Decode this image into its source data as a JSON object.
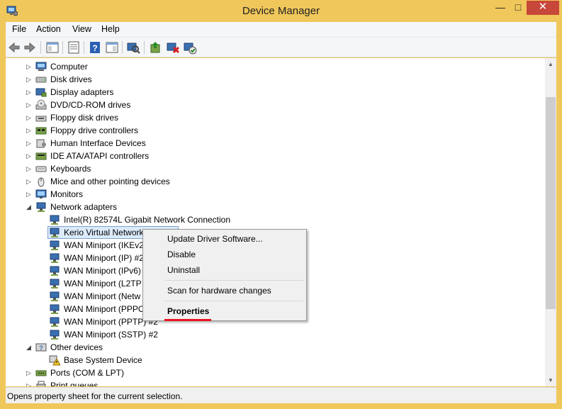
{
  "window": {
    "title": "Device Manager",
    "controls": {
      "minimize": "—",
      "maximize": "□",
      "close": "✕"
    }
  },
  "menubar": {
    "items": [
      "File",
      "Action",
      "View",
      "Help"
    ]
  },
  "toolbar": {
    "buttons": [
      "back-icon",
      "forward-icon",
      "show-hide-console-tree-icon",
      "properties-icon",
      "help-icon",
      "show-hide-action-pane-icon",
      "scan-hardware-icon",
      "update-driver-icon",
      "uninstall-icon",
      "enable-device-icon"
    ]
  },
  "tree": {
    "nodes": [
      {
        "label": "Computer",
        "expander": "▷",
        "icon": "computer-icon"
      },
      {
        "label": "Disk drives",
        "expander": "▷",
        "icon": "disk-drive-icon"
      },
      {
        "label": "Display adapters",
        "expander": "▷",
        "icon": "display-adapter-icon"
      },
      {
        "label": "DVD/CD-ROM drives",
        "expander": "▷",
        "icon": "dvd-drive-icon"
      },
      {
        "label": "Floppy disk drives",
        "expander": "▷",
        "icon": "floppy-drive-icon"
      },
      {
        "label": "Floppy drive controllers",
        "expander": "▷",
        "icon": "floppy-controller-icon"
      },
      {
        "label": "Human Interface Devices",
        "expander": "▷",
        "icon": "hid-icon"
      },
      {
        "label": "IDE ATA/ATAPI controllers",
        "expander": "▷",
        "icon": "ide-controller-icon"
      },
      {
        "label": "Keyboards",
        "expander": "▷",
        "icon": "keyboard-icon"
      },
      {
        "label": "Mice and other pointing devices",
        "expander": "▷",
        "icon": "mouse-icon"
      },
      {
        "label": "Monitors",
        "expander": "▷",
        "icon": "monitor-icon"
      },
      {
        "label": "Network adapters",
        "expander": "◢",
        "icon": "network-adapter-icon"
      },
      {
        "label": "Intel(R) 82574L Gigabit Network Connection",
        "icon": "network-card-icon"
      },
      {
        "label": "Kerio Virtual Network",
        "icon": "network-card-icon",
        "selected": true
      },
      {
        "label": "WAN Miniport (IKEv2",
        "icon": "network-card-icon"
      },
      {
        "label": "WAN Miniport (IP) #2",
        "icon": "network-card-icon"
      },
      {
        "label": "WAN Miniport (IPv6)",
        "icon": "network-card-icon"
      },
      {
        "label": "WAN Miniport (L2TP",
        "icon": "network-card-icon"
      },
      {
        "label": "WAN Miniport (Netw",
        "icon": "network-card-icon"
      },
      {
        "label": "WAN Miniport (PPPO",
        "icon": "network-card-icon"
      },
      {
        "label": "WAN Miniport (PPTP) #2",
        "icon": "network-card-icon"
      },
      {
        "label": "WAN Miniport (SSTP) #2",
        "icon": "network-card-icon"
      },
      {
        "label": "Other devices",
        "expander": "◢",
        "icon": "other-devices-icon"
      },
      {
        "label": "Base System Device",
        "icon": "warning-device-icon"
      },
      {
        "label": "Ports (COM & LPT)",
        "expander": "▷",
        "icon": "ports-icon"
      },
      {
        "label": "Print queues",
        "expander": "▷",
        "icon": "print-queue-icon"
      }
    ]
  },
  "context_menu": {
    "update_driver": "Update Driver Software...",
    "disable": "Disable",
    "uninstall": "Uninstall",
    "scan": "Scan for hardware changes",
    "properties": "Properties"
  },
  "status": {
    "text": "Opens property sheet for the current selection."
  },
  "colors": {
    "accent_frame": "#f0c75a",
    "close_button": "#c7473a",
    "highlight_underline": "#e8141e",
    "selection": "#dcebfc"
  }
}
